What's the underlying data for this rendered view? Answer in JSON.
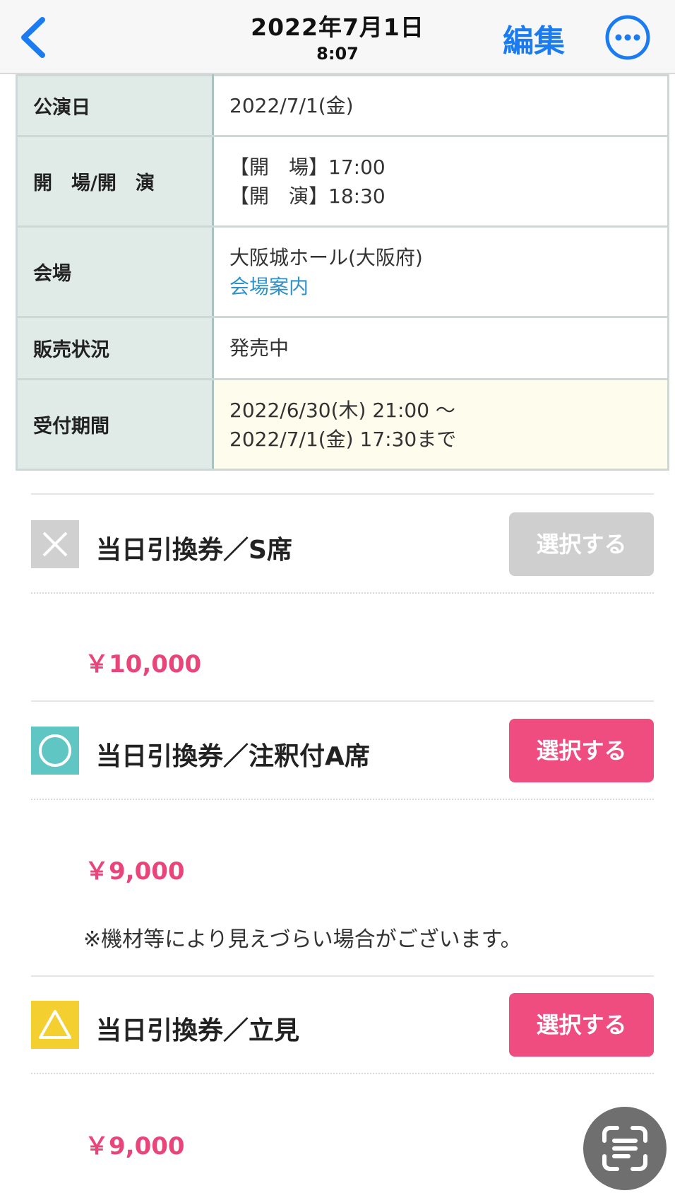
{
  "nav": {
    "title_date": "2022年7月1日",
    "title_time": "8:07",
    "edit_label": "編集",
    "accent_color": "#1a7cf0"
  },
  "info": {
    "rows": [
      {
        "label": "公演日",
        "lines": [
          "2022/7/1(金)"
        ]
      },
      {
        "label": "開　場/開　演",
        "lines": [
          "【開　場】17:00",
          "【開　演】18:30"
        ]
      },
      {
        "label": "会場",
        "lines": [
          "大阪城ホール(大阪府)"
        ],
        "link": "会場案内"
      },
      {
        "label": "販売状況",
        "lines": [
          "発売中"
        ]
      },
      {
        "label": "受付期間",
        "lines": [
          "2022/6/30(木) 21:00 〜",
          "2022/7/1(金) 17:30まで"
        ]
      }
    ]
  },
  "tickets": [
    {
      "status": "sold-out",
      "status_icon": "cross-icon",
      "name": "当日引換券／S席",
      "button": "選択する",
      "price": "￥10,000",
      "note": ""
    },
    {
      "status": "available",
      "status_icon": "circle-icon",
      "name": "当日引換券／注釈付A席",
      "button": "選択する",
      "price": "￥9,000",
      "note": "※機材等により見えづらい場合がございます。"
    },
    {
      "status": "few-left",
      "status_icon": "triangle-icon",
      "name": "当日引換券／立見",
      "button": "選択する",
      "price": "￥9,000",
      "note": ""
    }
  ],
  "colors": {
    "price": "#e9457a",
    "button_active": "#ef4d80",
    "button_disabled": "#cfcfcf",
    "badge_available": "#5fc6c4",
    "badge_few": "#f3d030",
    "badge_soldout": "#d0d0d0"
  }
}
